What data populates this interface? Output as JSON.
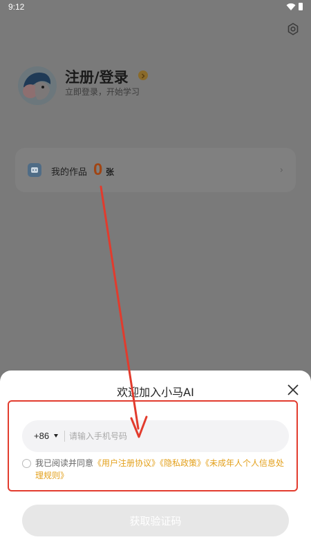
{
  "status_bar": {
    "time": "9:12"
  },
  "profile": {
    "title": "注册/登录",
    "subtitle": "立即登录，开始学习"
  },
  "works": {
    "label": "我的作品",
    "count": "0",
    "unit": "张"
  },
  "login_sheet": {
    "title": "欢迎加入小马AI",
    "country_code": "+86",
    "phone_placeholder": "请输入手机号码",
    "agreement_prefix": "我已阅读并同意",
    "agreement_links": [
      "《用户注册协议》",
      "《隐私政策》",
      "《未成年人个人信息处理规则》"
    ],
    "get_code_label": "获取验证码"
  },
  "colors": {
    "accent_link": "#e3a01b",
    "annotation": "#e23b2d",
    "count_color": "#a04514"
  }
}
